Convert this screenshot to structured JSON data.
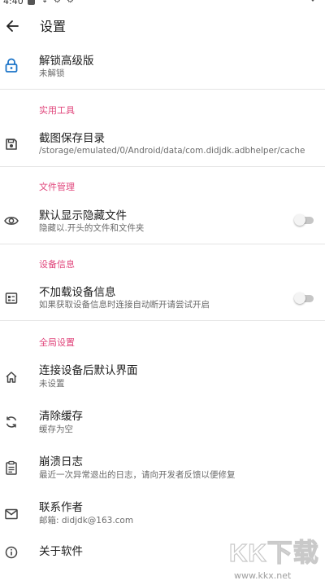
{
  "status_bar": {
    "time": "4:40",
    "glyph_a": "⇣",
    "glyph_b": "⚙"
  },
  "app_bar": {
    "title": "设置",
    "back_icon": "arrow-left-icon"
  },
  "colors": {
    "accent": "#e0457b",
    "lock_icon": "#1a73c8",
    "divider": "#e4e4e4"
  },
  "unlock": {
    "icon": "lock-icon",
    "title": "解锁高级版",
    "subtitle": "未解锁"
  },
  "sections": {
    "tools": {
      "header": "实用工具",
      "screenshot_dir": {
        "icon": "save-icon",
        "title": "截图保存目录",
        "subtitle": "/storage/emulated/0/Android/data/com.didjdk.adbhelper/cache"
      }
    },
    "files": {
      "header": "文件管理",
      "show_hidden": {
        "icon": "eye-icon",
        "title": "默认显示隐藏文件",
        "subtitle": "隐藏以.开头的文件和文件夹",
        "enabled": false
      }
    },
    "device": {
      "header": "设备信息",
      "no_device_info": {
        "icon": "device-info-icon",
        "title": "不加载设备信息",
        "subtitle": "如果获取设备信息时连接自动断开请尝试开启",
        "enabled": false
      }
    },
    "global": {
      "header": "全局设置",
      "default_screen": {
        "icon": "home-icon",
        "title": "连接设备后默认界面",
        "subtitle": "未设置"
      },
      "clear_cache": {
        "icon": "sync-icon",
        "title": "清除缓存",
        "subtitle": "缓存为空"
      },
      "crash_log": {
        "icon": "clipboard-icon",
        "title": "崩溃日志",
        "subtitle": "最近一次异常退出的日志，请向开发者反馈以便修复"
      },
      "contact": {
        "icon": "mail-icon",
        "title": "联系作者",
        "subtitle": "邮箱: didjdk@163.com"
      },
      "about": {
        "icon": "info-icon",
        "title": "关于软件"
      }
    }
  },
  "watermark": {
    "logo": "KK下载",
    "url": "www.kkx.net"
  }
}
